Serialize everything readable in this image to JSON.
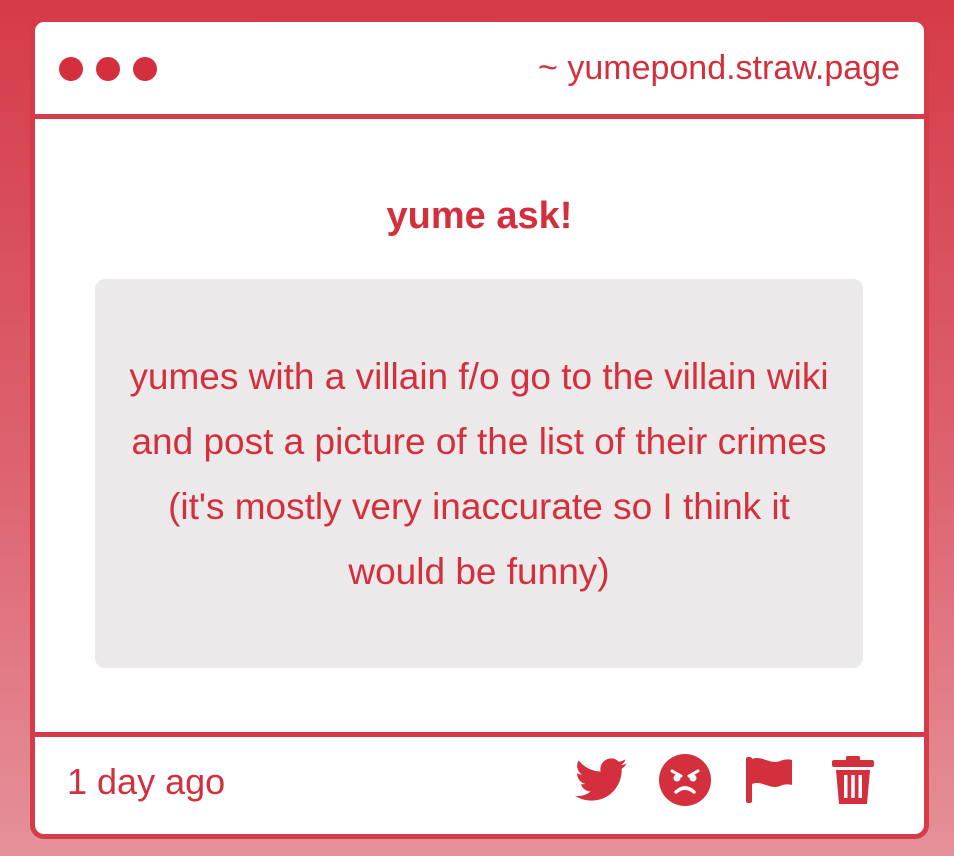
{
  "browser": {
    "url": "~ yumepond.straw.page"
  },
  "ask": {
    "title": "yume ask!",
    "question": "yumes with a villain f/o go to the villain wiki and post a picture of the list of their crimes (it's mostly very inaccurate so I think it would be funny)"
  },
  "footer": {
    "timestamp": "1 day ago",
    "actions": [
      "twitter-icon",
      "angry-face-icon",
      "flag-icon",
      "trash-icon"
    ]
  },
  "colors": {
    "accent": "#d32f3c",
    "background_top": "#d53b48",
    "background_bottom": "#e5919a",
    "question_box": "#ebe9ea"
  }
}
